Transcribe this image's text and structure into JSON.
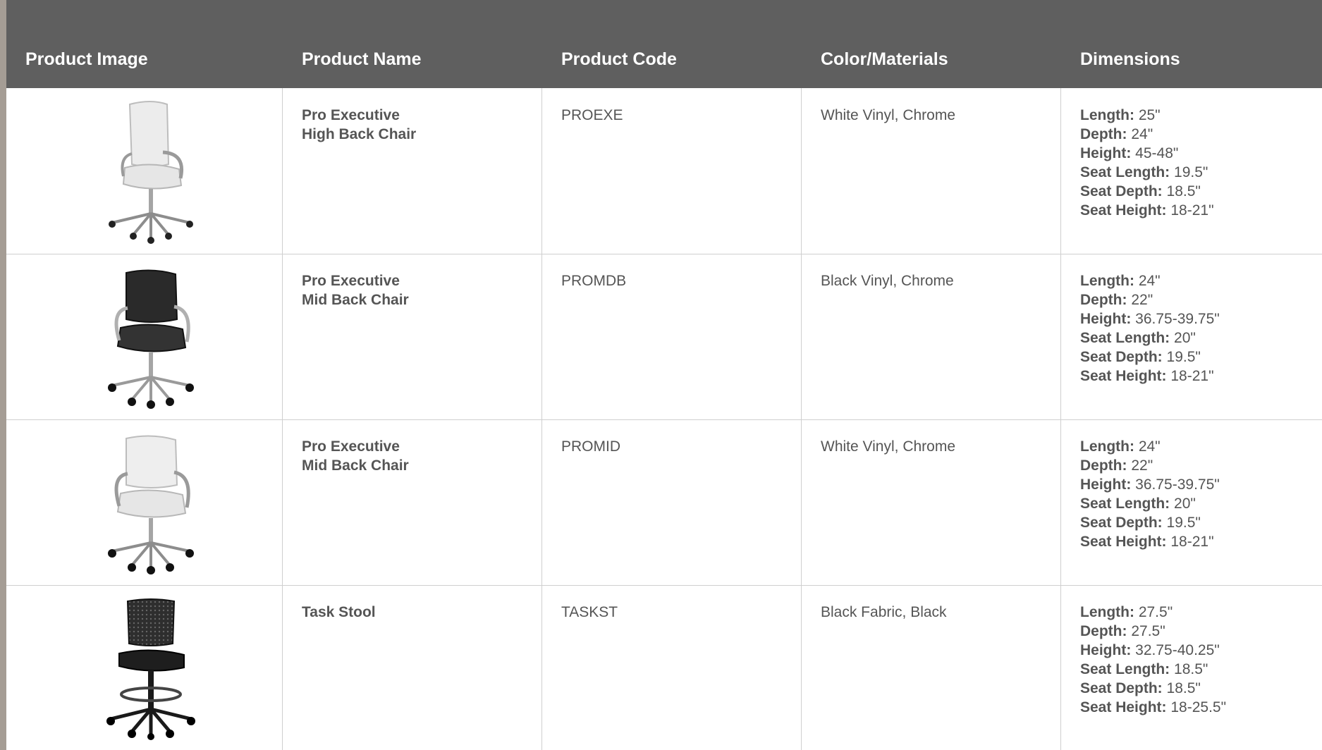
{
  "headers": {
    "image": "Product Image",
    "name": "Product Name",
    "code": "Product Code",
    "color": "Color/Materials",
    "dimensions": "Dimensions"
  },
  "rows": [
    {
      "image_icon": "white-high-back-office-chair",
      "name_line1": "Pro Executive",
      "name_line2": "High Back Chair",
      "code": "PROEXE",
      "color": "White Vinyl, Chrome",
      "dims": [
        {
          "label": "Length:",
          "value": "25\""
        },
        {
          "label": "Depth:",
          "value": "24\""
        },
        {
          "label": "Height:",
          "value": "45-48\""
        },
        {
          "label": "Seat Length:",
          "value": "19.5\""
        },
        {
          "label": "Seat Depth:",
          "value": "18.5\""
        },
        {
          "label": "Seat Height:",
          "value": "18-21\""
        }
      ]
    },
    {
      "image_icon": "black-mid-back-office-chair",
      "name_line1": "Pro Executive",
      "name_line2": "Mid Back Chair",
      "code": "PROMDB",
      "color": "Black Vinyl, Chrome",
      "dims": [
        {
          "label": "Length:",
          "value": "24\""
        },
        {
          "label": "Depth:",
          "value": "22\""
        },
        {
          "label": "Height:",
          "value": "36.75-39.75\""
        },
        {
          "label": "Seat Length:",
          "value": "20\""
        },
        {
          "label": "Seat Depth:",
          "value": "19.5\""
        },
        {
          "label": "Seat Height:",
          "value": "18-21\""
        }
      ]
    },
    {
      "image_icon": "white-mid-back-office-chair",
      "name_line1": "Pro Executive",
      "name_line2": "Mid Back Chair",
      "code": "PROMID",
      "color": "White Vinyl, Chrome",
      "dims": [
        {
          "label": "Length:",
          "value": "24\""
        },
        {
          "label": "Depth:",
          "value": "22\""
        },
        {
          "label": "Height:",
          "value": "36.75-39.75\""
        },
        {
          "label": "Seat Length:",
          "value": "20\""
        },
        {
          "label": "Seat Depth:",
          "value": "19.5\""
        },
        {
          "label": "Seat Height:",
          "value": "18-21\""
        }
      ]
    },
    {
      "image_icon": "black-mesh-task-stool",
      "name_line1": "Task Stool",
      "name_line2": "",
      "code": "TASKST",
      "color": "Black Fabric, Black",
      "dims": [
        {
          "label": "Length:",
          "value": "27.5\""
        },
        {
          "label": "Depth:",
          "value": "27.5\""
        },
        {
          "label": "Height:",
          "value": "32.75-40.25\""
        },
        {
          "label": "Seat Length:",
          "value": "18.5\""
        },
        {
          "label": "Seat Depth:",
          "value": "18.5\""
        },
        {
          "label": "Seat Height:",
          "value": "18-25.5\""
        }
      ]
    }
  ],
  "colors": {
    "header_bg": "#5f5f5f",
    "header_text": "#ffffff",
    "body_text": "#555555",
    "grid_line": "#cfcfcf",
    "page_edge": "#a59d95"
  }
}
